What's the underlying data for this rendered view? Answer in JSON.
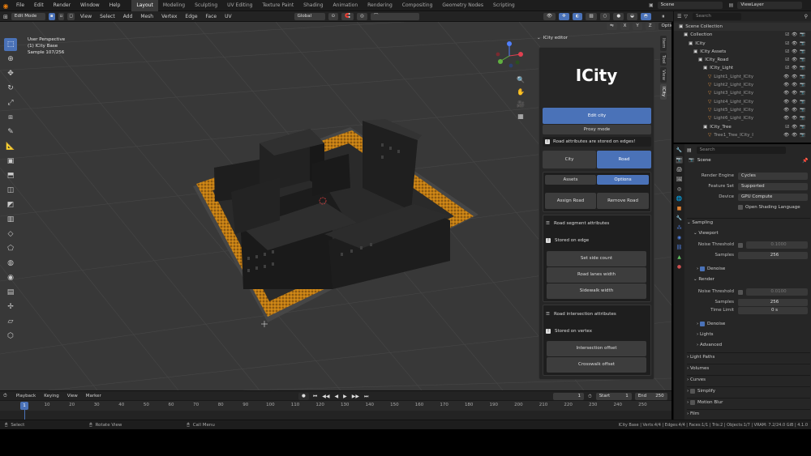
{
  "menu": [
    "File",
    "Edit",
    "Render",
    "Window",
    "Help"
  ],
  "workspaces": [
    "Layout",
    "Modeling",
    "Sculpting",
    "UV Editing",
    "Texture Paint",
    "Shading",
    "Animation",
    "Rendering",
    "Compositing",
    "Geometry Nodes",
    "Scripting"
  ],
  "scene_field": "Scene",
  "viewlayer_field": "ViewLayer",
  "header": {
    "mode": "Edit Mode",
    "menus": [
      "View",
      "Select",
      "Add",
      "Mesh",
      "Vertex",
      "Edge",
      "Face",
      "UV"
    ],
    "transform": "Global",
    "axes": [
      "X",
      "Y",
      "Z"
    ],
    "options": "Options"
  },
  "overlay": {
    "line1": "User Perspective",
    "line2": "(1) ICity Base",
    "line3": "Sample 107/256"
  },
  "ntabs": [
    "Item",
    "Tool",
    "View",
    "ICity"
  ],
  "icity": {
    "panel_title": "ICity editor",
    "logo": "ICity",
    "edit_city": "Edit city",
    "proxy_mode": "Proxy mode",
    "info": "Road attributes are stored on edges!",
    "tab_city": "City",
    "tab_road": "Road",
    "tab_assets": "Assets",
    "tab_options": "Options",
    "assign_road": "Assign Road",
    "remove_road": "Remove Road",
    "seg_title": "Road segment attributes",
    "seg_stored": "Stored on edge",
    "set_side": "Set side count",
    "road_lanes": "Road lanes width",
    "sidewalk": "Sidewalk width",
    "int_title": "Road intersection attributes",
    "int_stored": "Stored on vertex",
    "int_offset": "Intersection offset",
    "cross_offset": "Crosswalk offset"
  },
  "timeline": {
    "menus": [
      "Playback",
      "Keying",
      "View",
      "Marker"
    ],
    "frame": "1",
    "start_label": "Start",
    "start": "1",
    "end_label": "End",
    "end": "250",
    "ticks": [
      "1",
      "10",
      "20",
      "30",
      "40",
      "50",
      "60",
      "70",
      "80",
      "90",
      "100",
      "110",
      "120",
      "130",
      "140",
      "150",
      "160",
      "170",
      "180",
      "190",
      "200",
      "210",
      "220",
      "230",
      "240",
      "250"
    ]
  },
  "status": {
    "select": "Select",
    "rotate": "Rotate View",
    "call": "Call Menu",
    "stats": "ICity Base | Verts:4/4 | Edges:4/4 | Faces:1/1 | Tris:2 | Objects:1/7 | VRAM: 7.2/24.0 GiB | 4.1.0"
  },
  "outliner": {
    "search": "Search",
    "items": [
      {
        "label": "Scene Collection",
        "depth": 0
      },
      {
        "label": "Collection",
        "depth": 1
      },
      {
        "label": "ICity",
        "depth": 2
      },
      {
        "label": "ICity Assets",
        "depth": 3
      },
      {
        "label": "ICity_Road",
        "depth": 4
      },
      {
        "label": "ICity_Light",
        "depth": 5
      },
      {
        "label": "Light1_Light_ICity",
        "depth": 6
      },
      {
        "label": "Light2_Light_ICity",
        "depth": 6
      },
      {
        "label": "Light3_Light_ICity",
        "depth": 6
      },
      {
        "label": "Light4_Light_ICity",
        "depth": 6
      },
      {
        "label": "Light5_Light_ICity",
        "depth": 6
      },
      {
        "label": "Light6_Light_ICity",
        "depth": 6
      },
      {
        "label": "ICity_Tree",
        "depth": 5
      },
      {
        "label": "Tree1_Tree_ICity_I",
        "depth": 6
      }
    ]
  },
  "props": {
    "search": "Search",
    "scene": "Scene",
    "render_engine_label": "Render Engine",
    "render_engine": "Cycles",
    "feature_set_label": "Feature Set",
    "feature_set": "Supported",
    "device_label": "Device",
    "device": "GPU Compute",
    "osl": "Open Shading Language",
    "sampling": "Sampling",
    "viewport": "Viewport",
    "noise_label": "Noise Threshold",
    "vp_noise": "0.1000",
    "samples_label": "Samples",
    "vp_samples": "256",
    "denoise": "Denoise",
    "render": "Render",
    "r_noise": "0.0100",
    "r_samples": "256",
    "time_limit_label": "Time Limit",
    "time_limit": "0 s",
    "lights": "Lights",
    "advanced": "Advanced",
    "light_paths": "Light Paths",
    "volumes": "Volumes",
    "curves": "Curves",
    "simplify": "Simplify",
    "motion_blur": "Motion Blur",
    "film": "Film"
  },
  "colors": {
    "accent": "#4a72b8",
    "road": "#d4901e"
  }
}
